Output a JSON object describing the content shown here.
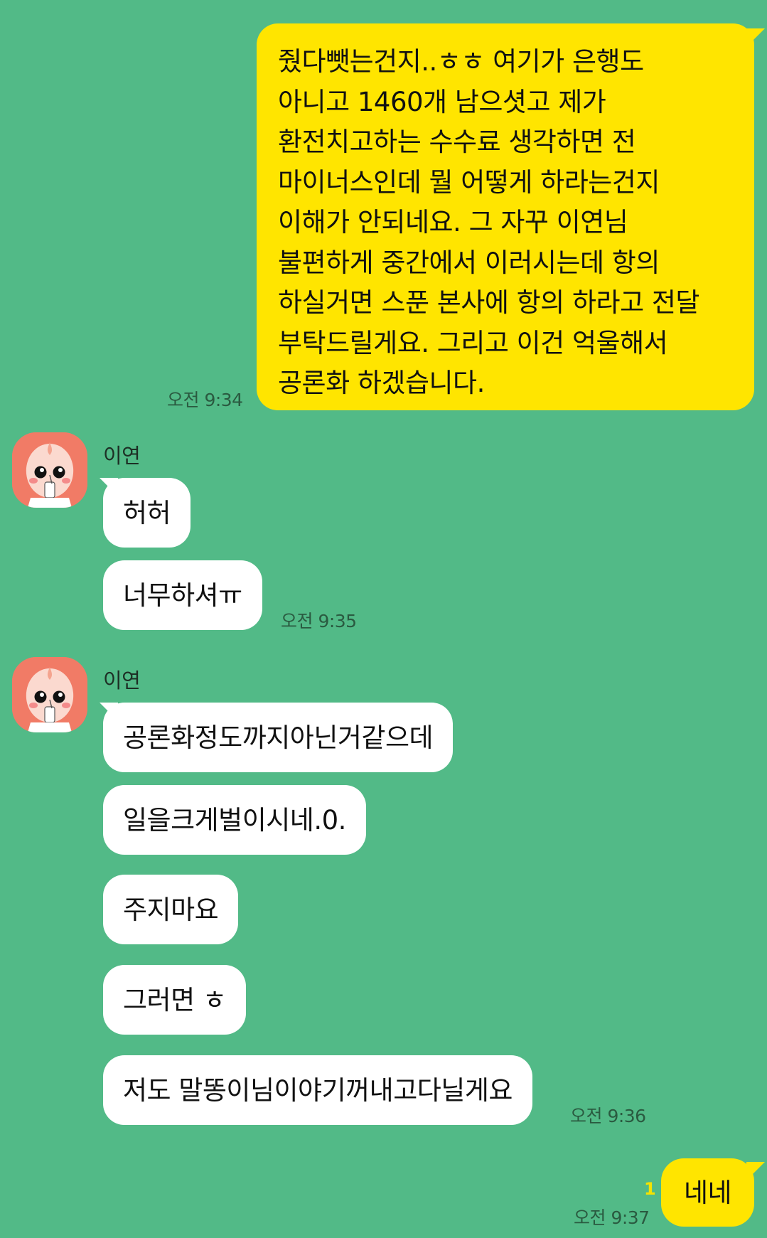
{
  "conversation": {
    "messages_out": {
      "long_message_lines": [
        "줬다뺏는건지..ㅎㅎ 여기가 은행도",
        "아니고 1460개 남으셧고 제가",
        "환전치고하는 수수료 생각하면 전",
        "마이너스인데 뭘 어떻게 하라는건지",
        "이해가 안되네요. 그 자꾸 이연님",
        "불편하게 중간에서 이러시는데 항의",
        "하실거면 스푼 본사에 항의 하라고 전달",
        "부탁드릴게요. 그리고 이건 억울해서",
        "공론화 하겠습니다."
      ],
      "long_message_time": "오전 9:34",
      "short_message": "네네",
      "short_message_time": "오전 9:37",
      "short_message_unread": "1"
    },
    "group1": {
      "sender": "이연",
      "messages": [
        "허허",
        "너무하셔ㅠ"
      ],
      "time": "오전 9:35"
    },
    "group2": {
      "sender": "이연",
      "messages": [
        "공론화정도까지아닌거같으데",
        "일을크게벌이시네.0.",
        "주지마요",
        "그러면 ㅎ",
        "저도 말똥이님이야기꺼내고다닐게요"
      ],
      "time": "오전 9:36"
    }
  },
  "colors": {
    "background": "#52ba87",
    "outgoing_bubble": "#ffe500",
    "incoming_bubble": "#ffffff",
    "avatar_bg": "#f17b66"
  },
  "icons": {
    "avatar": "peach-character-avatar"
  }
}
